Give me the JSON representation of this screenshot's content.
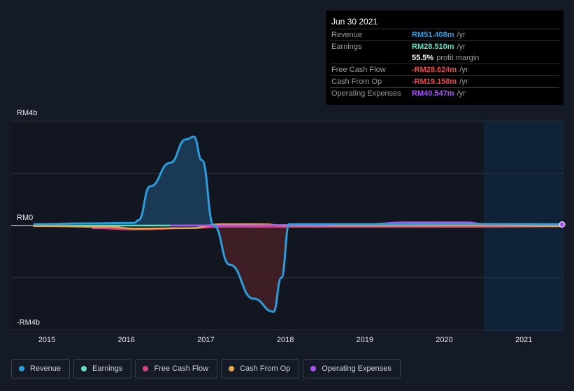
{
  "tooltip": {
    "date": "Jun 30 2021",
    "rows": [
      {
        "label": "Revenue",
        "value": "RM51.408m",
        "unit": "/yr",
        "color": "#2d9cdb"
      },
      {
        "label": "Earnings",
        "value": "RM28.510m",
        "unit": "/yr",
        "color": "#5fe0c7"
      },
      {
        "label": "",
        "value": "55.5%",
        "unit": "profit margin",
        "color": "#ffffff"
      },
      {
        "label": "Free Cash Flow",
        "value": "-RM28.624m",
        "unit": "/yr",
        "color": "#e84a4a"
      },
      {
        "label": "Cash From Op",
        "value": "-RM19.158m",
        "unit": "/yr",
        "color": "#e84a4a"
      },
      {
        "label": "Operating Expenses",
        "value": "RM40.547m",
        "unit": "/yr",
        "color": "#a855f7"
      }
    ]
  },
  "chart_data": {
    "type": "line",
    "y_tick_labels": [
      "RM4b",
      "RM0",
      "-RM4b"
    ],
    "ylim": [
      -4,
      4
    ],
    "x_tick_labels": [
      "2015",
      "2016",
      "2017",
      "2018",
      "2019",
      "2020",
      "2021"
    ],
    "xlim": [
      2014.7,
      2021.5
    ],
    "forecast_start": 2020.5,
    "series": [
      {
        "name": "Revenue",
        "color": "#2d9cdb",
        "x": [
          2014.83,
          2015.5,
          2016.1,
          2016.15,
          2016.3,
          2016.55,
          2016.75,
          2016.85,
          2016.95,
          2017.1,
          2017.3,
          2017.6,
          2017.85,
          2017.95,
          2018.05,
          2019,
          2020.5,
          2021.5
        ],
        "y": [
          0.05,
          0.08,
          0.1,
          0.2,
          1.5,
          2.4,
          3.3,
          3.4,
          2.5,
          0,
          -1.5,
          -2.8,
          -3.3,
          -2,
          0.05,
          0.05,
          0.06,
          0.05
        ]
      },
      {
        "name": "Earnings",
        "color": "#5fe0c7",
        "x": [
          2014.83,
          2016,
          2016.55,
          2017,
          2018,
          2020.5,
          2021.5
        ],
        "y": [
          -0.02,
          0.0,
          0.0,
          0.0,
          -0.02,
          0.0,
          0.03
        ]
      },
      {
        "name": "Free Cash Flow",
        "color": "#d6417f",
        "x": [
          2015.57,
          2016.1,
          2016.8,
          2017.2,
          2018,
          2020.5,
          2021.5
        ],
        "y": [
          -0.1,
          -0.15,
          -0.1,
          -0.05,
          -0.05,
          -0.05,
          -0.03
        ]
      },
      {
        "name": "Cash From Op",
        "color": "#e9a84e",
        "x": [
          2014.83,
          2015.8,
          2016.1,
          2016.8,
          2017.2,
          2017.7,
          2018,
          2020.5,
          2021.5
        ],
        "y": [
          -0.02,
          -0.05,
          -0.12,
          -0.1,
          0.05,
          0.05,
          0.0,
          0.0,
          -0.02
        ]
      },
      {
        "name": "Operating Expenses",
        "color": "#a855f7",
        "x": [
          2016.55,
          2017.5,
          2018,
          2019,
          2019.5,
          2020.3,
          2020.5,
          2021.5
        ],
        "y": [
          0.0,
          0.0,
          0.02,
          0.05,
          0.12,
          0.12,
          0.05,
          0.04
        ]
      }
    ]
  },
  "legend": [
    "Revenue",
    "Earnings",
    "Free Cash Flow",
    "Cash From Op",
    "Operating Expenses"
  ]
}
